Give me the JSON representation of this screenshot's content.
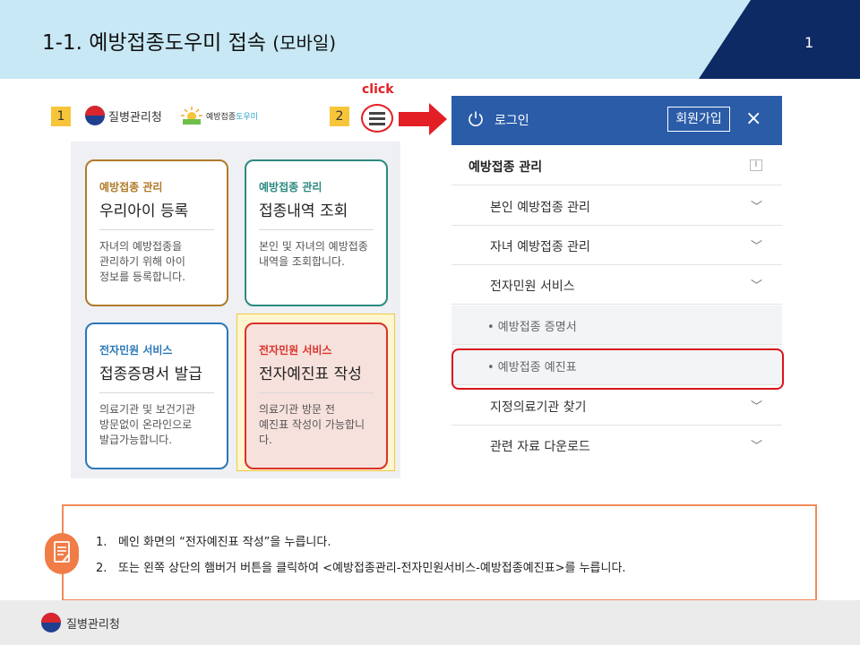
{
  "header": {
    "title": "1-1. 예방접종도우미 접속",
    "title_suffix": "(모바일)",
    "page_number": "1"
  },
  "left_site": {
    "step1_badge": "1",
    "step2_badge": "2",
    "click_label": "click",
    "logo_kdca": "질병관리청",
    "logo_vax_a": "예방접종",
    "logo_vax_b": "도우미",
    "cards": [
      {
        "category": "예방접종 관리",
        "title": "우리아이 등록",
        "desc": [
          "자녀의 예방접종을",
          "관리하기 위해 아이",
          "정보를 등록합니다."
        ],
        "color": "#b07a2a"
      },
      {
        "category": "예방접종 관리",
        "title": "접종내역 조회",
        "desc": [
          "본인 및 자녀의 예방접종",
          "내역을 조회합니다."
        ],
        "color": "#2c8a80"
      },
      {
        "category": "전자민원 서비스",
        "title": "접종증명서 발급",
        "desc": [
          "의료기관 및 보건기관",
          "방문없이 온라인으로",
          "발급가능합니다."
        ],
        "color": "#2b78b8"
      },
      {
        "category": "전자민원 서비스",
        "title": "전자예진표 작성",
        "desc": [
          "의료기관 방문 전",
          "예진표 작성이 가능합니다."
        ],
        "color": "#d9332b"
      }
    ]
  },
  "drawer": {
    "login": "로그인",
    "join": "회원가입",
    "close": "×",
    "section": "예방접종 관리",
    "items": [
      "본인 예방접종 관리",
      "자녀 예방접종 관리",
      "전자민원 서비스"
    ],
    "subitems": [
      "• 예방접종 증명서",
      "• 예방접종 예진표"
    ],
    "items_after": [
      "지정의료기관 찾기",
      "관련 자료 다운로드"
    ]
  },
  "note": {
    "n1": "1.",
    "line1": "메인 화면의 “전자예진표 작성”을 누릅니다.",
    "n2": "2.",
    "line2": "또는 왼쪽 상단의 햄버거 버튼을 클릭하여 <예방접종관리-전자민원서비스-예방접종예진표>를 누릅니다."
  },
  "footer": {
    "logo_text": "질병관리청"
  }
}
